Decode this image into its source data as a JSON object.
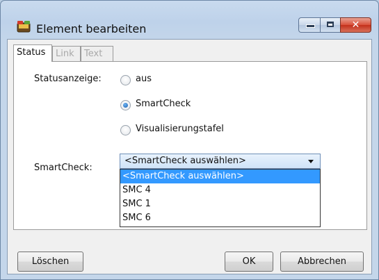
{
  "window": {
    "title": "Element bearbeiten",
    "icon": "app-icon",
    "controls": [
      "minimize-icon",
      "maximize-icon",
      "close-icon"
    ]
  },
  "tabs": [
    {
      "label": "Status",
      "active": true
    },
    {
      "label": "Link",
      "active": false
    },
    {
      "label": "Text",
      "active": false
    }
  ],
  "status": {
    "label": "Statusanzeige:",
    "options": [
      {
        "label": "aus",
        "checked": false
      },
      {
        "label": "SmartCheck",
        "checked": true
      },
      {
        "label": "Visualisierungstafel",
        "checked": false
      }
    ]
  },
  "smartcheck": {
    "label": "SmartCheck:",
    "selected": "<SmartCheck auswählen>",
    "options": [
      "<SmartCheck auswählen>",
      "SMC 4",
      "SMC 1",
      "SMC 6"
    ],
    "highlighted_index": 0
  },
  "buttons": {
    "delete": "Löschen",
    "ok": "OK",
    "cancel": "Abbrechen"
  },
  "colors": {
    "selection": "#3399ff",
    "close_button": "#c3301b"
  }
}
